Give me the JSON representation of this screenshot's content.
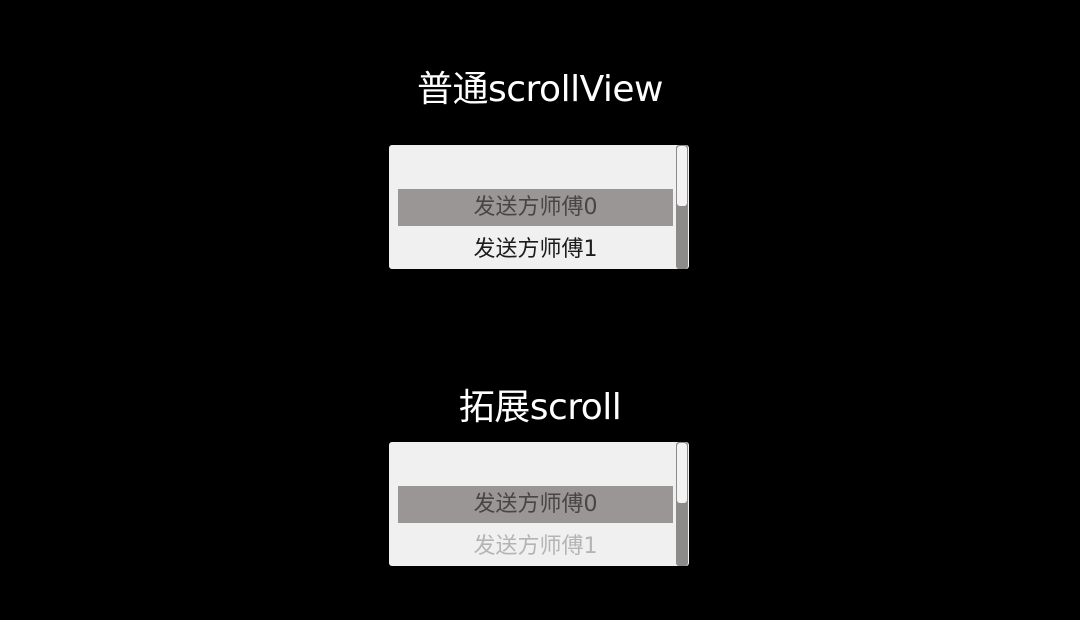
{
  "sections": [
    {
      "title": "普通scrollView",
      "items": [
        {
          "label": "发送方师傅0",
          "state": "selected"
        },
        {
          "label": "发送方师傅1",
          "state": "normal"
        }
      ],
      "scroll_position": 0.0
    },
    {
      "title": "拓展scroll",
      "items": [
        {
          "label": "发送方师傅0",
          "state": "selected"
        },
        {
          "label": "发送方师傅1",
          "state": "faded"
        }
      ],
      "scroll_position": 0.0
    }
  ],
  "colors": {
    "background": "#000000",
    "list_background": "#f1f0f0",
    "selected_item": "#9b9696",
    "scrollbar_track": "#8d8a8a",
    "scrollbar_thumb": "#f4f3f3"
  }
}
